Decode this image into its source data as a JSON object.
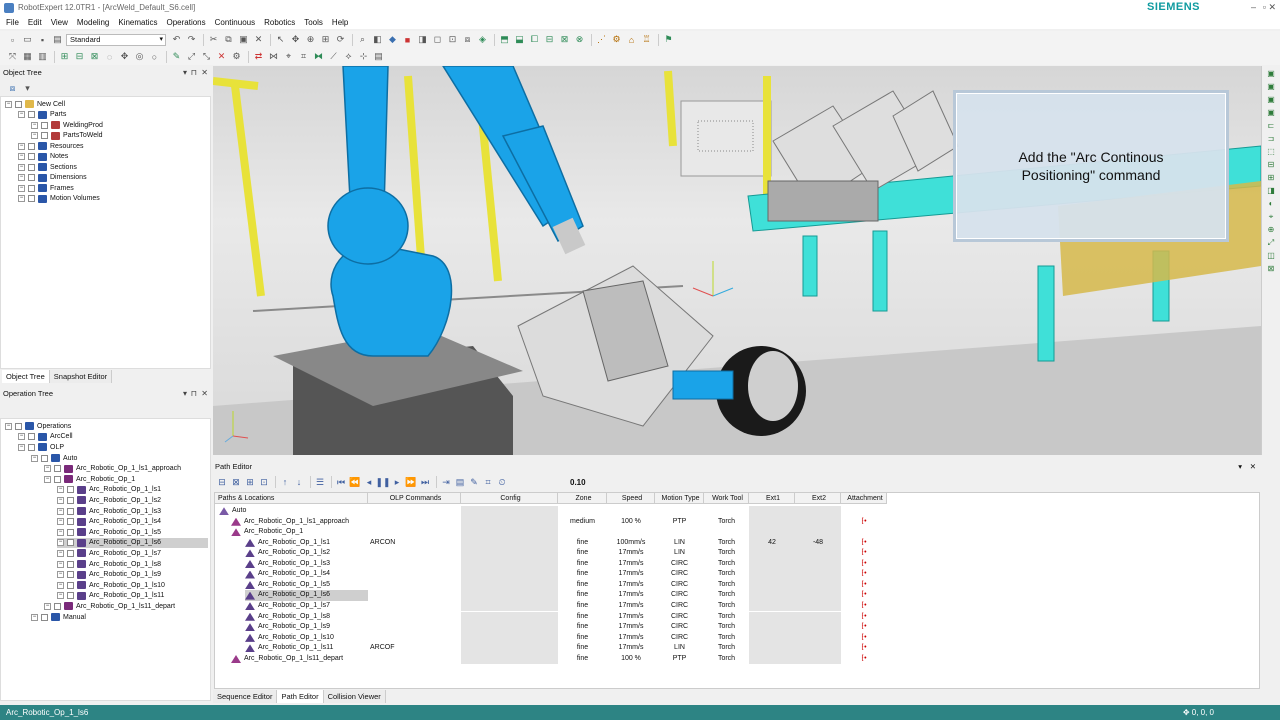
{
  "window": {
    "title": "RobotExpert 12.0TR1 - [ArcWeld_Default_S6.cell]",
    "brand": "SIEMENS",
    "controls": [
      "–",
      "▫",
      "✕"
    ]
  },
  "menu": [
    "File",
    "Edit",
    "View",
    "Modeling",
    "Kinematics",
    "Operations",
    "Continuous",
    "Robotics",
    "Tools",
    "Help"
  ],
  "toolbar": {
    "layout_select": "Standard"
  },
  "object_tree": {
    "title": "Object Tree",
    "items": [
      {
        "label": "New Cell",
        "level": 0
      },
      {
        "label": "Parts",
        "level": 1
      },
      {
        "label": "WeldingProd",
        "level": 2
      },
      {
        "label": "PartsToWeld",
        "level": 2
      },
      {
        "label": "Resources",
        "level": 1
      },
      {
        "label": "Notes",
        "level": 1
      },
      {
        "label": "Sections",
        "level": 1
      },
      {
        "label": "Dimensions",
        "level": 1
      },
      {
        "label": "Frames",
        "level": 1
      },
      {
        "label": "Motion Volumes",
        "level": 1
      }
    ],
    "tabs": [
      "Object Tree",
      "Snapshot Editor"
    ]
  },
  "operation_tree": {
    "title": "Operation Tree",
    "items": [
      {
        "label": "Operations",
        "level": 0
      },
      {
        "label": "ArcCell",
        "level": 1
      },
      {
        "label": "OLP",
        "level": 1
      },
      {
        "label": "Auto",
        "level": 2
      },
      {
        "label": "Arc_Robotic_Op_1_ls1_approach",
        "level": 3
      },
      {
        "label": "Arc_Robotic_Op_1",
        "level": 3
      },
      {
        "label": "Arc_Robotic_Op_1_ls1",
        "level": 4
      },
      {
        "label": "Arc_Robotic_Op_1_ls2",
        "level": 4
      },
      {
        "label": "Arc_Robotic_Op_1_ls3",
        "level": 4
      },
      {
        "label": "Arc_Robotic_Op_1_ls4",
        "level": 4
      },
      {
        "label": "Arc_Robotic_Op_1_ls5",
        "level": 4
      },
      {
        "label": "Arc_Robotic_Op_1_ls6",
        "level": 4
      },
      {
        "label": "Arc_Robotic_Op_1_ls7",
        "level": 4
      },
      {
        "label": "Arc_Robotic_Op_1_ls8",
        "level": 4
      },
      {
        "label": "Arc_Robotic_Op_1_ls9",
        "level": 4
      },
      {
        "label": "Arc_Robotic_Op_1_ls10",
        "level": 4
      },
      {
        "label": "Arc_Robotic_Op_1_ls11",
        "level": 4
      },
      {
        "label": "Arc_Robotic_Op_1_ls11_depart",
        "level": 3
      },
      {
        "label": "Manual",
        "level": 2
      }
    ],
    "selected_label": "Arc_Robotic_Op_1_ls6"
  },
  "viewport": {
    "callout": "Add the \"Arc Continous\nPositioning\" command"
  },
  "path_editor": {
    "title": "Path Editor",
    "value": "0.10",
    "columns": [
      "Paths & Locations",
      "OLP Commands",
      "Config",
      "Zone",
      "Speed",
      "Motion Type",
      "Work Tool",
      "Ext1",
      "Ext2",
      "Attachment"
    ],
    "rows": [
      {
        "name": "Auto",
        "olp": "",
        "zone": "",
        "speed": "",
        "motion": "",
        "tool": "",
        "ext1": "",
        "ext2": ""
      },
      {
        "name": "Arc_Robotic_Op_1_ls1_approach",
        "olp": "",
        "zone": "medium",
        "speed": "100 %",
        "motion": "PTP",
        "tool": "Torch",
        "ext1": "",
        "ext2": ""
      },
      {
        "name": "Arc_Robotic_Op_1",
        "olp": "",
        "zone": "",
        "speed": "",
        "motion": "",
        "tool": "",
        "ext1": "",
        "ext2": ""
      },
      {
        "name": "Arc_Robotic_Op_1_ls1",
        "olp": "ARCON",
        "zone": "fine",
        "speed": "100mm/s",
        "motion": "LIN",
        "tool": "Torch",
        "ext1": "42",
        "ext2": "-48"
      },
      {
        "name": "Arc_Robotic_Op_1_ls2",
        "olp": "",
        "zone": "fine",
        "speed": "17mm/s",
        "motion": "LIN",
        "tool": "Torch",
        "ext1": "",
        "ext2": ""
      },
      {
        "name": "Arc_Robotic_Op_1_ls3",
        "olp": "",
        "zone": "fine",
        "speed": "17mm/s",
        "motion": "CIRC",
        "tool": "Torch",
        "ext1": "",
        "ext2": ""
      },
      {
        "name": "Arc_Robotic_Op_1_ls4",
        "olp": "",
        "zone": "fine",
        "speed": "17mm/s",
        "motion": "CIRC",
        "tool": "Torch",
        "ext1": "",
        "ext2": ""
      },
      {
        "name": "Arc_Robotic_Op_1_ls5",
        "olp": "",
        "zone": "fine",
        "speed": "17mm/s",
        "motion": "CIRC",
        "tool": "Torch",
        "ext1": "",
        "ext2": ""
      },
      {
        "name": "Arc_Robotic_Op_1_ls6",
        "olp": "",
        "zone": "fine",
        "speed": "17mm/s",
        "motion": "CIRC",
        "tool": "Torch",
        "ext1": "",
        "ext2": ""
      },
      {
        "name": "Arc_Robotic_Op_1_ls7",
        "olp": "",
        "zone": "fine",
        "speed": "17mm/s",
        "motion": "CIRC",
        "tool": "Torch",
        "ext1": "",
        "ext2": ""
      },
      {
        "name": "Arc_Robotic_Op_1_ls8",
        "olp": "",
        "zone": "fine",
        "speed": "17mm/s",
        "motion": "CIRC",
        "tool": "Torch",
        "ext1": "",
        "ext2": ""
      },
      {
        "name": "Arc_Robotic_Op_1_ls9",
        "olp": "",
        "zone": "fine",
        "speed": "17mm/s",
        "motion": "CIRC",
        "tool": "Torch",
        "ext1": "",
        "ext2": ""
      },
      {
        "name": "Arc_Robotic_Op_1_ls10",
        "olp": "",
        "zone": "fine",
        "speed": "17mm/s",
        "motion": "CIRC",
        "tool": "Torch",
        "ext1": "",
        "ext2": ""
      },
      {
        "name": "Arc_Robotic_Op_1_ls11",
        "olp": "ARCOF",
        "zone": "fine",
        "speed": "17mm/s",
        "motion": "LIN",
        "tool": "Torch",
        "ext1": "",
        "ext2": ""
      },
      {
        "name": "Arc_Robotic_Op_1_ls11_depart",
        "olp": "",
        "zone": "fine",
        "speed": "100 %",
        "motion": "PTP",
        "tool": "Torch",
        "ext1": "",
        "ext2": ""
      }
    ],
    "selected_row": "Arc_Robotic_Op_1_ls6",
    "tabs": [
      "Sequence Editor",
      "Path Editor",
      "Collision Viewer"
    ]
  },
  "status": {
    "selection": "Arc_Robotic_Op_1_ls6",
    "coords": "0, 0, 0"
  },
  "colors": {
    "robot": "#1aa3e8",
    "conveyor": "#3fe0d8",
    "safety_fence": "#e8e23a",
    "statusbar": "#2d8484",
    "brand": "#0f9ba0"
  }
}
